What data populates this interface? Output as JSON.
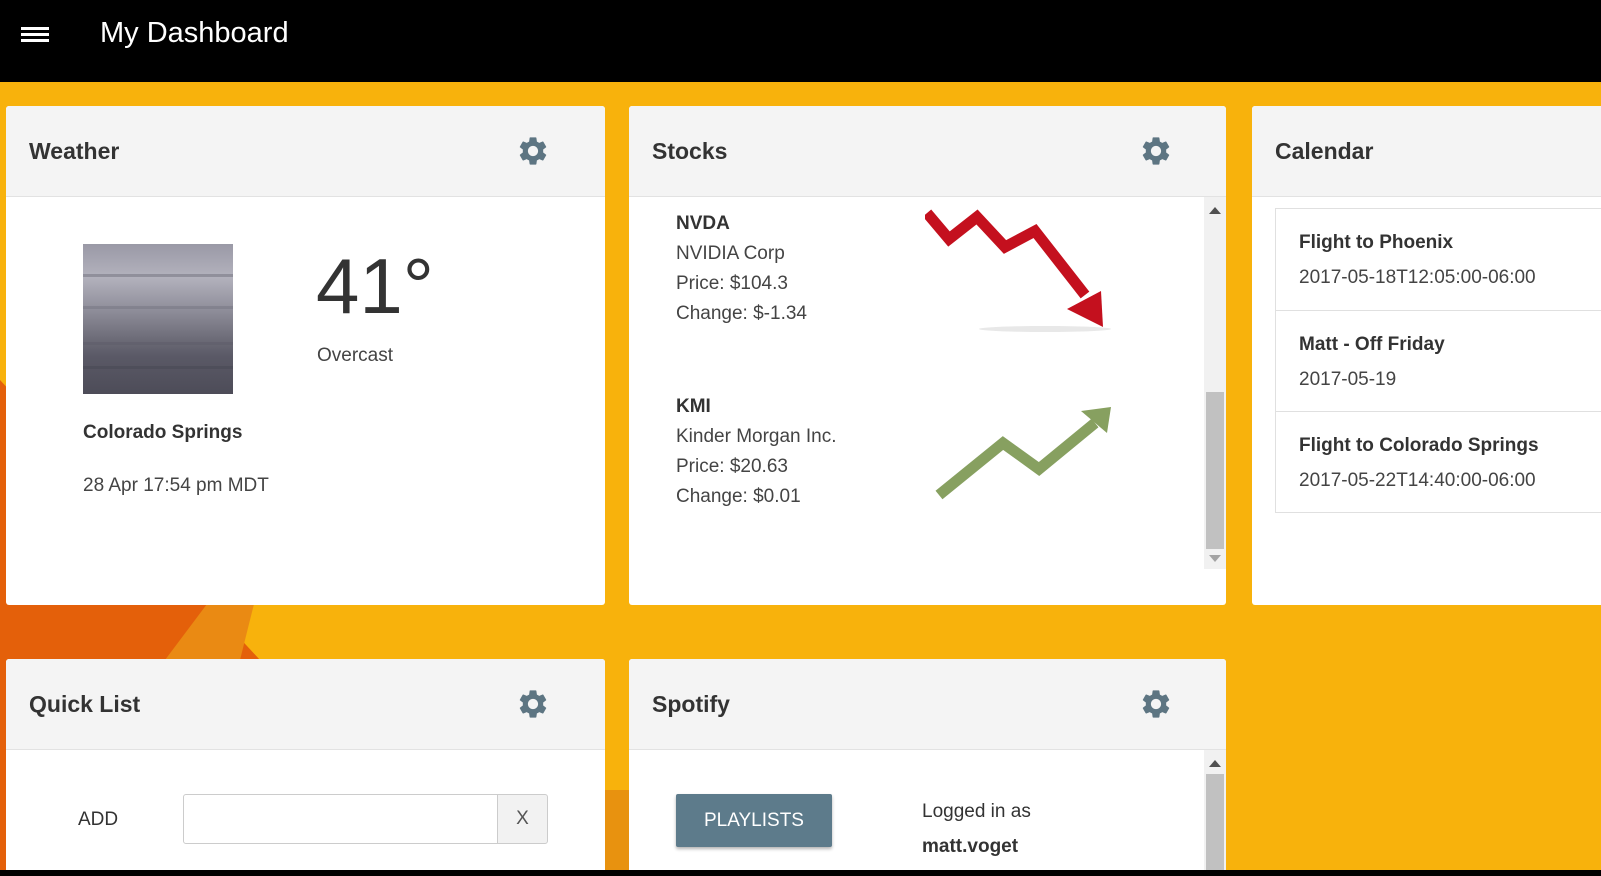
{
  "app": {
    "title": "My Dashboard"
  },
  "colors": {
    "topbar": "#000000",
    "background": "#f8b20c",
    "accent_orange": "#e4600a",
    "button": "#5d7b8b",
    "gear": "#5d7582",
    "stock_down": "#c4101e",
    "stock_up": "#87a060"
  },
  "weather": {
    "title": "Weather",
    "temperature": "41°",
    "condition": "Overcast",
    "city": "Colorado Springs",
    "datetime": "28 Apr 17:54 pm MDT",
    "icon": "overcast-sky-photo"
  },
  "stocks": {
    "title": "Stocks",
    "items": [
      {
        "symbol": "NVDA",
        "name": "NVIDIA Corp",
        "price": "Price: $104.3",
        "change": "Change: $-1.34",
        "trend": "down"
      },
      {
        "symbol": "KMI",
        "name": "Kinder Morgan Inc.",
        "price": "Price: $20.63",
        "change": "Change: $0.01",
        "trend": "up"
      }
    ]
  },
  "calendar": {
    "title": "Calendar",
    "events": [
      {
        "name": "Flight to Phoenix",
        "when": "2017-05-18T12:05:00-06:00"
      },
      {
        "name": "Matt - Off Friday",
        "when": "2017-05-19"
      },
      {
        "name": "Flight to Colorado Springs",
        "when": "2017-05-22T14:40:00-06:00"
      }
    ]
  },
  "quicklist": {
    "title": "Quick List",
    "add_label": "ADD",
    "input_value": "",
    "input_placeholder": "",
    "clear_label": "X"
  },
  "spotify": {
    "title": "Spotify",
    "playlists_label": "PLAYLISTS",
    "logged_in_label": "Logged in as",
    "username": "matt.voget"
  }
}
